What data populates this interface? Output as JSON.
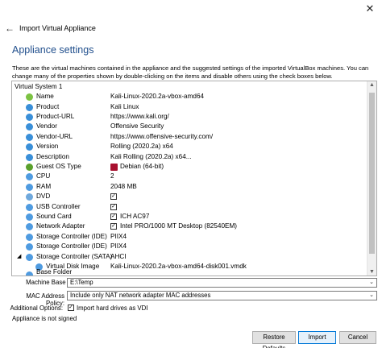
{
  "window": {
    "close_glyph": "✕"
  },
  "header": {
    "title": "Import Virtual Appliance",
    "back_glyph": "←"
  },
  "section": {
    "title": "Appliance settings"
  },
  "description": "These are the virtual machines contained in the appliance and the suggested settings of the imported VirtualBox machines. You can change many of the properties shown by double-clicking on the items and disable others using the check boxes below.",
  "tree": {
    "group": "Virtual System 1",
    "rows": [
      {
        "icon": "name-icon",
        "color": "#7cc243",
        "label": "Name",
        "value": "Kali-Linux-2020.2a-vbox-amd64"
      },
      {
        "icon": "product-icon",
        "color": "#3a8fd8",
        "label": "Product",
        "value": "Kali Linux"
      },
      {
        "icon": "product-url-icon",
        "color": "#3a8fd8",
        "label": "Product-URL",
        "value": "https://www.kali.org/"
      },
      {
        "icon": "vendor-icon",
        "color": "#3a8fd8",
        "label": "Vendor",
        "value": "Offensive Security"
      },
      {
        "icon": "vendor-url-icon",
        "color": "#3a8fd8",
        "label": "Vendor-URL",
        "value": "https://www.offensive-security.com/"
      },
      {
        "icon": "version-icon",
        "color": "#3a8fd8",
        "label": "Version",
        "value": "Rolling (2020.2a) x64"
      },
      {
        "icon": "description-icon",
        "color": "#3a8fd8",
        "label": "Description",
        "value": "Kali Rolling (2020.2a) x64..."
      },
      {
        "icon": "guest-os-icon",
        "color": "#5aa02c",
        "label": "Guest OS Type",
        "value": "Debian (64-bit)",
        "os_icon": true
      },
      {
        "icon": "cpu-icon",
        "color": "#4f9be0",
        "label": "CPU",
        "value": "2"
      },
      {
        "icon": "ram-icon",
        "color": "#4f9be0",
        "label": "RAM",
        "value": "2048 MB"
      },
      {
        "icon": "dvd-icon",
        "color": "#6fa8dc",
        "label": "DVD",
        "check": true,
        "value": ""
      },
      {
        "icon": "usb-icon",
        "color": "#4f9be0",
        "label": "USB Controller",
        "check": true,
        "value": ""
      },
      {
        "icon": "sound-icon",
        "color": "#4f9be0",
        "label": "Sound Card",
        "check": true,
        "value": "ICH AC97"
      },
      {
        "icon": "network-icon",
        "color": "#4f9be0",
        "label": "Network Adapter",
        "check": true,
        "value": "Intel PRO/1000 MT Desktop (82540EM)"
      },
      {
        "icon": "storage-ide-icon",
        "color": "#4f9be0",
        "label": "Storage Controller (IDE)",
        "value": "PIIX4"
      },
      {
        "icon": "storage-ide-icon",
        "color": "#4f9be0",
        "label": "Storage Controller (IDE)",
        "value": "PIIX4"
      },
      {
        "icon": "storage-sata-icon",
        "color": "#4f9be0",
        "label": "Storage Controller (SATA)",
        "value": "AHCI",
        "expanded": true
      },
      {
        "icon": "disk-icon",
        "color": "#4f9be0",
        "label": "Virtual Disk Image",
        "value": "Kali-Linux-2020.2a-vbox-amd64-disk001.vmdk",
        "child": true
      }
    ],
    "partial_row": "Base Folder",
    "scroll": {
      "up": "▲",
      "down": "▼"
    }
  },
  "form": {
    "base_folder_label": "Machine Base Folder:",
    "base_folder_value": "E:\\Temp",
    "mac_policy_label": "MAC Address Policy:",
    "mac_policy_value": "Include only NAT network adapter MAC addresses",
    "options_label": "Additional Options:",
    "import_vdi_label": "Import hard drives as VDI",
    "combo_glyph": "⌄"
  },
  "status": "Appliance is not signed",
  "buttons": {
    "restore": "Restore Defaults",
    "import": "Import",
    "cancel": "Cancel"
  },
  "check_glyph": "✓"
}
